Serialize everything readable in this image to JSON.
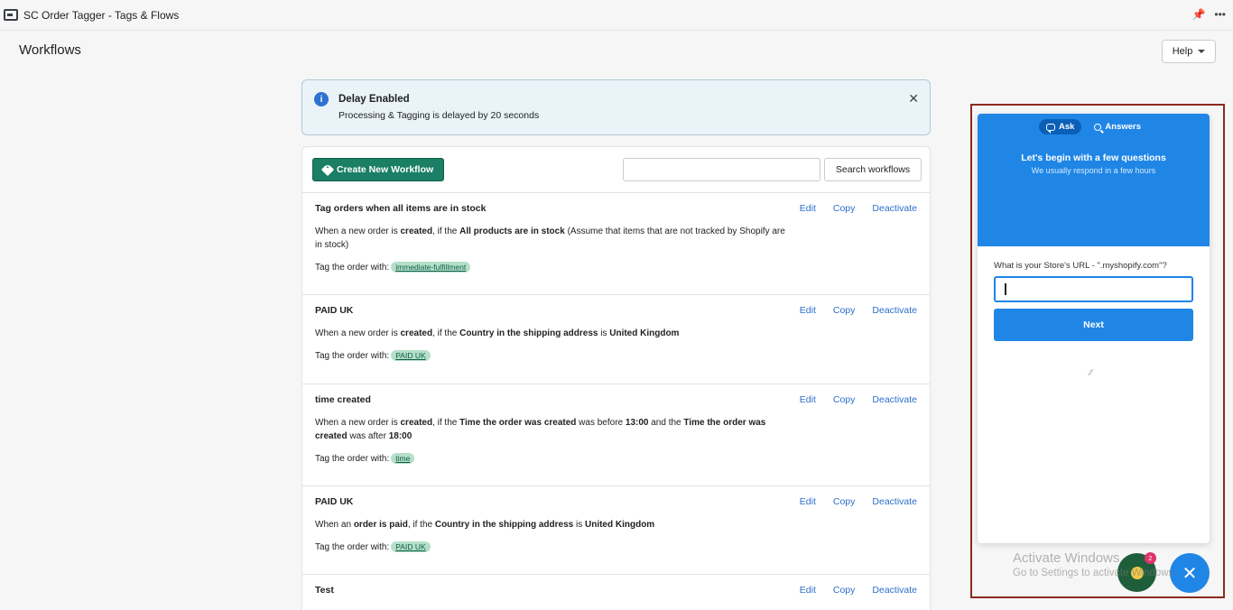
{
  "app": {
    "title": "SC Order Tagger - Tags & Flows",
    "pin_icon": "pin-icon",
    "more_icon": "more-dots-icon",
    "more_label": "•••"
  },
  "page": {
    "title": "Workflows",
    "help_label": "Help"
  },
  "banner": {
    "title": "Delay Enabled",
    "text": "Processing & Tagging is delayed by 20 seconds",
    "close_label": "✕"
  },
  "toolbar": {
    "create_label": "Create New Workflow",
    "search_placeholder": "",
    "search_button": "Search workflows"
  },
  "workflows": [
    {
      "name": "Tag orders when all items are in stock",
      "desc_parts": [
        "When a new order is ",
        "created",
        ", if the ",
        "All products are in stock",
        " (Assume that items that are not tracked by Shopify are in stock)"
      ],
      "tag_prefix": "Tag the order with:",
      "tag": "immediate-fulfillment"
    },
    {
      "name": "PAID UK",
      "desc_parts": [
        "When a new order is ",
        "created",
        ", if the ",
        "Country in the shipping address",
        " is ",
        "United Kingdom"
      ],
      "tag_prefix": "Tag the order with:",
      "tag": "PAID UK"
    },
    {
      "name": "time created",
      "desc_parts": [
        "When a new order is ",
        "created",
        ", if the ",
        "Time the order was created",
        " was before ",
        "13:00",
        " and the ",
        "Time the order was created",
        " was after ",
        "18:00"
      ],
      "tag_prefix": "Tag the order with:",
      "tag": "time"
    },
    {
      "name": "PAID UK",
      "desc_parts": [
        "When an ",
        "order is paid",
        ", if the ",
        "Country in the shipping address",
        " is ",
        "United Kingdom"
      ],
      "tag_prefix": "Tag the order with:",
      "tag": "PAID UK"
    },
    {
      "name": "Test",
      "desc_parts": [],
      "tag_prefix": "",
      "tag": ""
    }
  ],
  "actions": {
    "edit": "Edit",
    "copy": "Copy",
    "deactivate": "Deactivate"
  },
  "chat": {
    "tab_ask": "Ask",
    "tab_answers": "Answers",
    "headline": "Let's begin with a few questions",
    "subline": "We usually respond in a few hours",
    "question": "What is your Store's URL - \".myshopify.com\"?",
    "input_value": "",
    "next_label": "Next",
    "brand_icon": "brand-slash-icon",
    "badge_count": "2",
    "close_label": "✕"
  },
  "watermark": {
    "title": "Activate Windows",
    "subtitle": "Go to Settings to activate Windows."
  },
  "colors": {
    "primary_green": "#1a7f64",
    "link_blue": "#2c6ecb",
    "chat_blue": "#1f86e6",
    "banner_bg": "#eaf4f8",
    "frame_red": "#8b2a1d"
  }
}
